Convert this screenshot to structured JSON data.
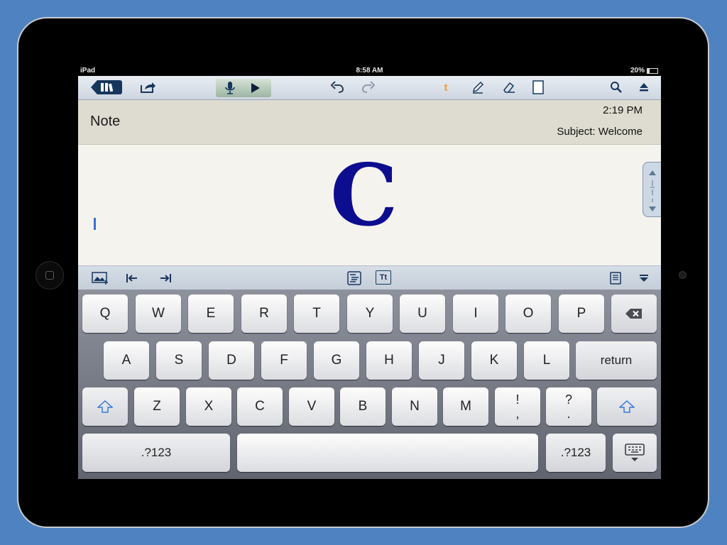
{
  "status_bar": {
    "device": "iPad",
    "time": "8:58 AM",
    "battery": "20%",
    "battery_level": 0.2
  },
  "toolbar": {
    "library_icon": "library-icon",
    "share_icon": "share-icon",
    "mic_icon": "microphone-icon",
    "play_icon": "play-icon",
    "undo_icon": "undo-icon",
    "redo_icon": "redo-icon",
    "text_tool_label": "t",
    "pen_icon": "pen-icon",
    "eraser_icon": "eraser-icon",
    "page_icon": "page-icon",
    "search_icon": "search-icon",
    "eject_icon": "eject-icon"
  },
  "note": {
    "title": "Note",
    "time": "2:19 PM",
    "subject": "Subject: Welcome",
    "handwritten_char": "C"
  },
  "edit_toolbar": {
    "insert_image_icon": "insert-image-icon",
    "outdent_icon": "outdent-icon",
    "indent_icon": "indent-icon",
    "format_icon": "format-icon",
    "text_size_label": "Tt",
    "page_view_icon": "page-view-icon",
    "collapse_icon": "collapse-icon"
  },
  "colors": {
    "accent_blue": "#0d0d8f",
    "cursor": "#3b6fcf",
    "toolbar_dark": "#17365e",
    "text_tool": "#f39c1f"
  },
  "keyboard": {
    "row1": [
      "Q",
      "W",
      "E",
      "R",
      "T",
      "Y",
      "U",
      "I",
      "O",
      "P"
    ],
    "row2": [
      "A",
      "S",
      "D",
      "F",
      "G",
      "H",
      "J",
      "K",
      "L"
    ],
    "row3": [
      "Z",
      "X",
      "C",
      "V",
      "B",
      "N",
      "M"
    ],
    "return_label": "return",
    "excl_top": "!",
    "excl_bottom": ",",
    "quest_top": "?",
    "quest_bottom": ".",
    "numbers_label": ".?123",
    "backspace_icon": "backspace-icon",
    "shift_icon": "shift-icon",
    "hide_keyboard_icon": "hide-keyboard-icon"
  }
}
